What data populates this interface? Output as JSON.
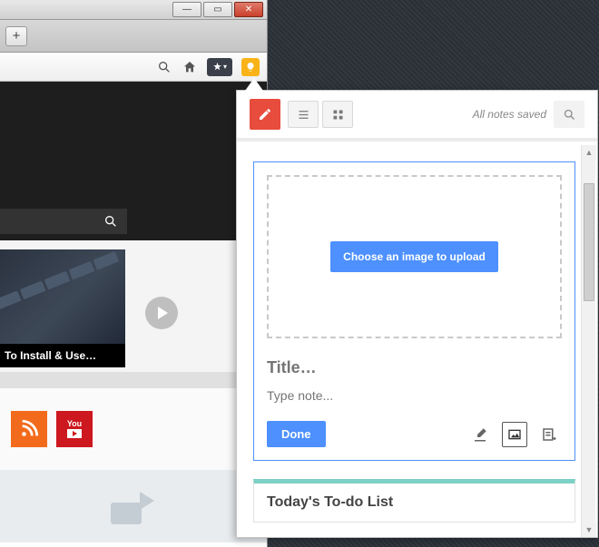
{
  "browser": {
    "window_controls": {
      "min": "—",
      "max": "▭",
      "close": "✕"
    },
    "new_tab_symbol": "+",
    "toolbar": {
      "search_icon": "search",
      "home_icon": "home",
      "bookmarks_icon": "star",
      "keep_icon": "bulb"
    }
  },
  "page": {
    "thumbnail_caption": "To Install & Use…",
    "social": {
      "rss_label": "RSS",
      "youtube_label": "You\nTube"
    }
  },
  "keep_panel": {
    "status_text": "All notes saved",
    "compose": {
      "choose_image_label": "Choose an image to upload",
      "title_placeholder": "Title…",
      "note_placeholder": "Type note...",
      "done_label": "Done"
    },
    "notes": [
      {
        "title": "Today's To-do List"
      }
    ]
  }
}
